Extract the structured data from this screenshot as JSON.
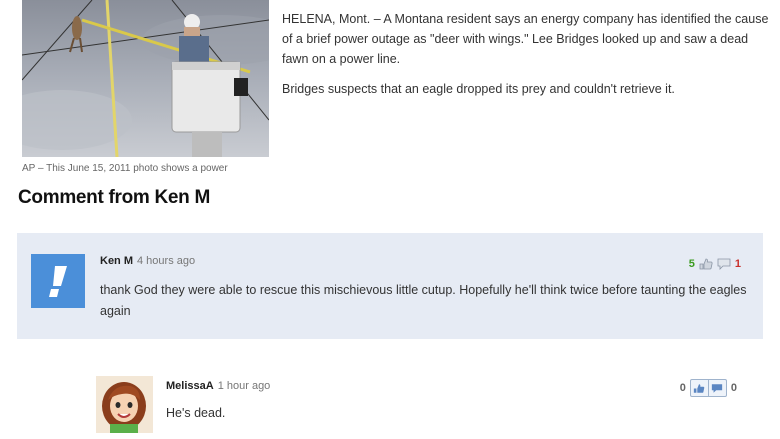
{
  "photo": {
    "caption": "AP – This June 15, 2011 photo shows a power"
  },
  "article": {
    "paragraph_1": "HELENA, Mont. – A Montana resident says an energy company has identified the cause of a brief power outage as \"deer with wings.\" Lee Bridges looked up and saw a dead fawn on a power line.",
    "paragraph_2": "Bridges suspects that an eagle dropped its prey and couldn't retrieve it."
  },
  "section": {
    "title": "Comment from Ken M"
  },
  "comment": {
    "author": "Ken M",
    "time": "4 hours ago",
    "text": "thank God they were able to rescue this mischievous little cutup. Hopefully he'll think twice before taunting the eagles again",
    "thumbs_up": "5",
    "thumbs_down": "1",
    "avatar_icon": "yahoo-exclamation-icon",
    "avatar_color": "#4b8fd9"
  },
  "reply": {
    "author": "MelissaA",
    "time": "1 hour ago",
    "text": "He's dead.",
    "thumbs_up": "0",
    "thumbs_down": "0",
    "avatar_icon": "cartoon-woman-avatar"
  },
  "colors": {
    "comment_bg": "#e6ebf4",
    "up_green": "#3b9b1f",
    "down_red": "#c9302c"
  }
}
